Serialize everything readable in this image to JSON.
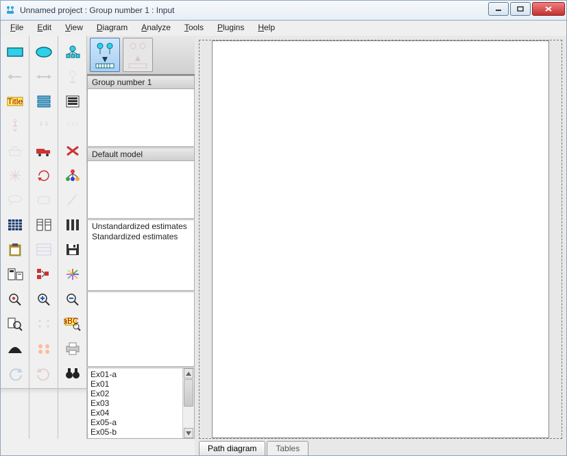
{
  "window": {
    "title": "Unnamed project : Group number 1 : Input"
  },
  "menu": {
    "file": {
      "label": "File",
      "key": "F"
    },
    "edit": {
      "label": "Edit",
      "key": "E"
    },
    "view": {
      "label": "View",
      "key": "V"
    },
    "diagram": {
      "label": "Diagram",
      "key": "D"
    },
    "analyze": {
      "label": "Analyze",
      "key": "A"
    },
    "tools": {
      "label": "Tools",
      "key": "T"
    },
    "plugins": {
      "label": "Plugins",
      "key": "P"
    },
    "help": {
      "label": "Help",
      "key": "H"
    }
  },
  "toolbox": {
    "col1": [
      "observed-rect",
      "left-arrow",
      "title",
      "select-one",
      "basket",
      "resize-flower",
      "draw-lasso",
      "data-table",
      "clipboard",
      "stats-panel",
      "zoom-target",
      "zoom-page",
      "distribution",
      "undo"
    ],
    "col2": [
      "latent-ellipse",
      "double-arrow",
      "variables-list",
      "select-multi",
      "truck",
      "rotate",
      "scroll-panel",
      "linked-vars",
      "spreadsheet",
      "reorder",
      "zoom-in",
      "rearrange",
      "faces",
      "redo"
    ],
    "col3": [
      "indicator",
      "error-circle",
      "variables-box",
      "select-all",
      "delete-x",
      "tree-colored",
      "wand",
      "columns",
      "save",
      "fireworks",
      "zoom-out",
      "abc-zoom",
      "print",
      "binoculars"
    ]
  },
  "mode": {
    "input_icon": "input-mode",
    "output_icon": "output-mode"
  },
  "panels": {
    "groups": {
      "header": "Group number 1"
    },
    "models": {
      "header": "Default model"
    },
    "estimates": {
      "rows": [
        "Unstandardized estimates",
        "Standardized estimates"
      ]
    }
  },
  "files": {
    "items": [
      "Ex01-a",
      "Ex01",
      "Ex02",
      "Ex03",
      "Ex04",
      "Ex05-a",
      "Ex05-b"
    ]
  },
  "tabs": {
    "path": "Path diagram",
    "tables": "Tables"
  }
}
